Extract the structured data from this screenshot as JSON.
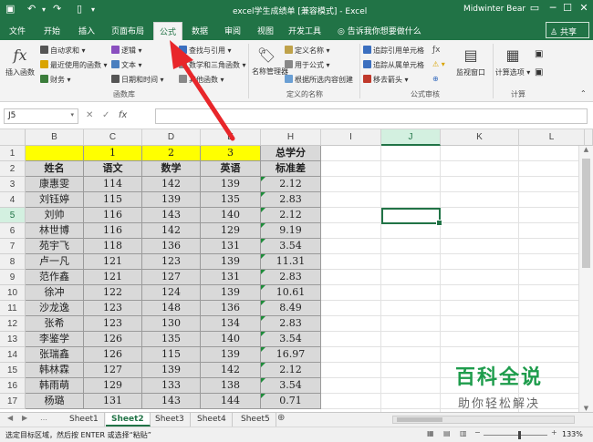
{
  "titlebar": {
    "title": "excel学生成绩单  [兼容模式]  -  Excel",
    "user": "Midwinter Bear",
    "save_icon": "save-icon",
    "undo_icon": "undo-icon",
    "redo_icon": "redo-icon"
  },
  "tabs": [
    "文件",
    "开始",
    "插入",
    "页面布局",
    "公式",
    "数据",
    "审阅",
    "视图",
    "开发工具"
  ],
  "active_tab": "公式",
  "tell_me": "告诉我你想要做什么",
  "share": "共享",
  "ribbon": {
    "insert_function": "插入函数",
    "function_library": {
      "autosum": "自动求和",
      "recent": "最近使用的函数",
      "financial": "财务",
      "logical": "逻辑",
      "text": "文本",
      "datetime": "日期和时间",
      "lookup": "查找与引用",
      "math": "数学和三角函数",
      "more": "其他函数",
      "label": "函数库"
    },
    "defined_names": {
      "name_manager": "名称管理器",
      "define_name": "定义名称",
      "use_in_formula": "用于公式",
      "create_from_selection": "根据所选内容创建",
      "label": "定义的名称"
    },
    "formula_auditing": {
      "trace_precedents": "追踪引用单元格",
      "trace_dependents": "追踪从属单元格",
      "remove_arrows": "移去箭头",
      "watch_window": "监视窗口",
      "label": "公式审核"
    },
    "calculation": {
      "options": "计算选项",
      "label": "计算"
    }
  },
  "formula_bar": {
    "name_box": "J5",
    "fx": "fx",
    "value": ""
  },
  "columns": [
    "B",
    "C",
    "D",
    "E",
    "H",
    "I",
    "J",
    "K",
    "L"
  ],
  "rows": [
    "1",
    "2",
    "3",
    "4",
    "5",
    "6",
    "7",
    "8",
    "9",
    "10",
    "11",
    "12",
    "13",
    "14",
    "15",
    "16",
    "17"
  ],
  "selected_cell": "J5",
  "table": {
    "row1": [
      "",
      "1",
      "2",
      "3",
      "总学分"
    ],
    "headers": [
      "姓名",
      "语文",
      "数学",
      "英语",
      "标准差"
    ],
    "data": [
      [
        "康惠雯",
        "114",
        "142",
        "139",
        "2.12"
      ],
      [
        "刘钰婷",
        "115",
        "139",
        "135",
        "2.83"
      ],
      [
        "刘帅",
        "116",
        "143",
        "140",
        "2.12"
      ],
      [
        "林世博",
        "116",
        "142",
        "129",
        "9.19"
      ],
      [
        "苑宇飞",
        "118",
        "136",
        "131",
        "3.54"
      ],
      [
        "卢一凡",
        "121",
        "123",
        "139",
        "11.31"
      ],
      [
        "范作鑫",
        "121",
        "127",
        "131",
        "2.83"
      ],
      [
        "徐冲",
        "122",
        "124",
        "139",
        "10.61"
      ],
      [
        "沙龙逸",
        "123",
        "148",
        "136",
        "8.49"
      ],
      [
        "张希",
        "123",
        "130",
        "134",
        "2.83"
      ],
      [
        "李鉴学",
        "126",
        "135",
        "140",
        "3.54"
      ],
      [
        "张瑞鑫",
        "126",
        "115",
        "139",
        "16.97"
      ],
      [
        "韩林霖",
        "127",
        "139",
        "142",
        "2.12"
      ],
      [
        "韩雨萌",
        "129",
        "133",
        "138",
        "3.54"
      ],
      [
        "杨璐",
        "131",
        "143",
        "144",
        "0.71"
      ]
    ]
  },
  "sheets": [
    "Sheet1",
    "Sheet2",
    "Sheet3",
    "Sheet4",
    "Sheet5"
  ],
  "active_sheet": "Sheet2",
  "status": {
    "message": "选定目标区域，然后按 ENTER 或选择“粘贴”",
    "zoom": "133%"
  },
  "watermark": {
    "title": "百科全说",
    "subtitle": "助你轻松解决"
  },
  "colors": {
    "excel_green": "#217346",
    "highlight_yellow": "#ffff00",
    "cell_gray": "#d9d9d9",
    "arrow_red": "#e8262a"
  }
}
